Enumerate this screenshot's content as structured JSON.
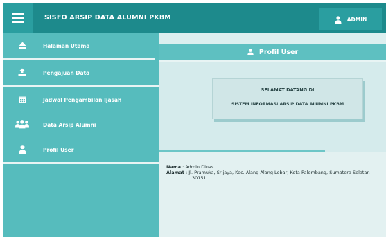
{
  "header": {
    "app_title": "SISFO ARSIP DATA ALUMNI PKBM",
    "user_label": "ADMIN",
    "icons": {
      "menu": "hamburger-menu-icon",
      "user": "user-icon"
    }
  },
  "sidebar": {
    "items": [
      {
        "label": "Halaman Utama",
        "icon": "eject-icon"
      },
      {
        "label": "Pengajuan Data",
        "icon": "upload-icon"
      },
      {
        "label": "Jadwal Pengambilan Ijasah",
        "icon": "calendar-icon"
      },
      {
        "label": "Data Arsip Alumni",
        "icon": "users-icon"
      },
      {
        "label": "Profil User",
        "icon": "user-icon"
      }
    ]
  },
  "main": {
    "section_title": "Profil User",
    "welcome": {
      "line1": "SELAMAT DATANG DI",
      "line2": "SISTEM INFORMASI ARSIP DATA ALUMNI PKBM"
    },
    "profile": {
      "name_key": "Nama",
      "name_value": ": Admin Dinas",
      "address_key": "Alamat",
      "address_value": ": Jl. Pramuka, Srijaya, Kec. Alang-Alang Lebar, Kota Palembang, Sumatera Selatan",
      "address_value_cont": "30151"
    }
  },
  "colors": {
    "header": "#1d8a8c",
    "sidebar": "#56bcbd",
    "main_background": "#d5ebec",
    "accent_bar": "#5ec0c1"
  }
}
